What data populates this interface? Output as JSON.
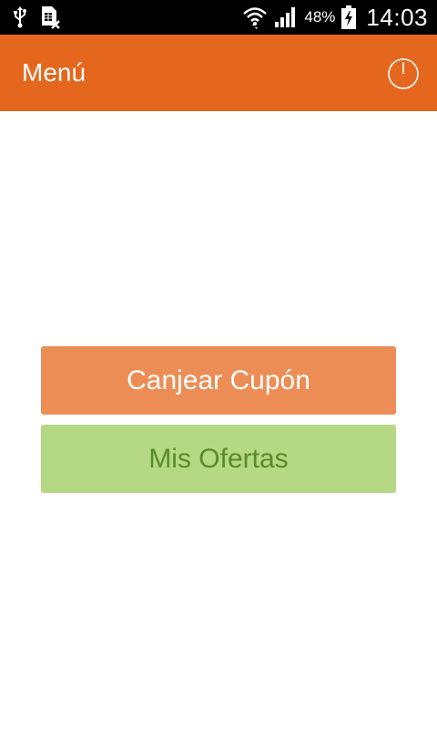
{
  "status_bar": {
    "battery_percent": "48%",
    "time": "14:03",
    "icons": [
      "usb-icon",
      "sim-card-icon",
      "wifi-icon",
      "signal-icon",
      "battery-charging-icon"
    ]
  },
  "action_bar": {
    "title": "Menú",
    "power_icon": "power-icon"
  },
  "menu": {
    "redeem_coupon_label": "Canjear Cupón",
    "my_offers_label": "Mis Ofertas"
  },
  "colors": {
    "action_bar_bg": "#e5671e",
    "redeem_button_bg": "#ec8d55",
    "offers_button_bg": "#b4d884",
    "offers_button_text": "#5a8a2a"
  }
}
